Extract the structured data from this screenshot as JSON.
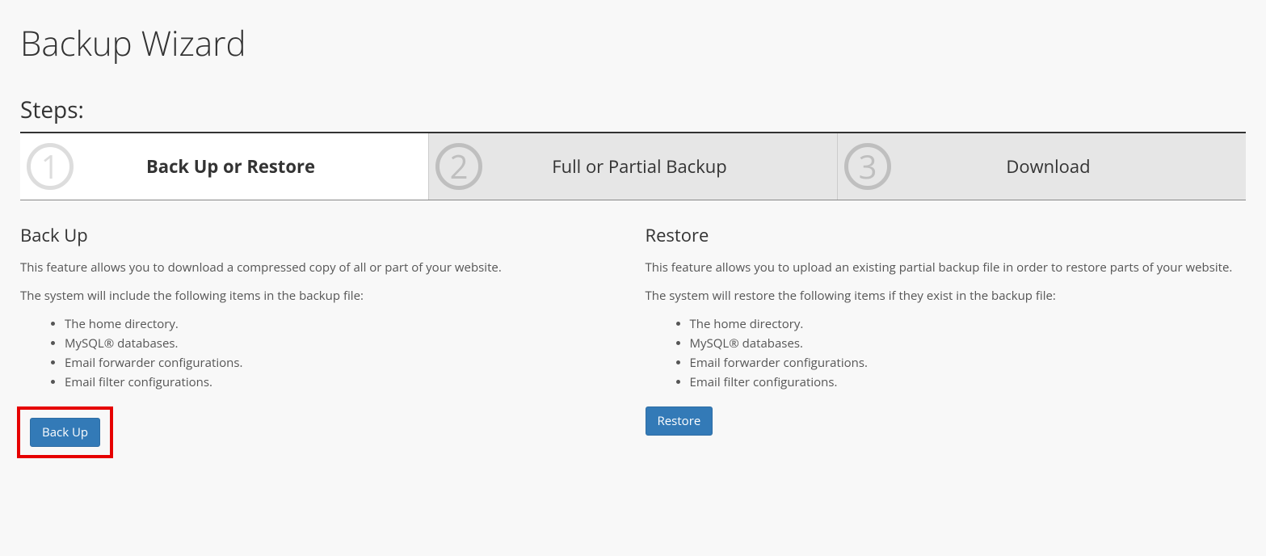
{
  "page_title": "Backup Wizard",
  "steps_heading": "Steps:",
  "steps": [
    {
      "number": "1",
      "label": "Back Up or Restore",
      "active": true
    },
    {
      "number": "2",
      "label": "Full or Partial Backup",
      "active": false
    },
    {
      "number": "3",
      "label": "Download",
      "active": false
    }
  ],
  "backup": {
    "heading": "Back Up",
    "intro": "This feature allows you to download a compressed copy of all or part of your website.",
    "list_intro": "The system will include the following items in the backup file:",
    "items": [
      "The home directory.",
      "MySQL® databases.",
      "Email forwarder configurations.",
      "Email filter configurations."
    ],
    "button_label": "Back Up"
  },
  "restore": {
    "heading": "Restore",
    "intro": "This feature allows you to upload an existing partial backup file in order to restore parts of your website.",
    "list_intro": "The system will restore the following items if they exist in the backup file:",
    "items": [
      "The home directory.",
      "MySQL® databases.",
      "Email forwarder configurations.",
      "Email filter configurations."
    ],
    "button_label": "Restore"
  }
}
